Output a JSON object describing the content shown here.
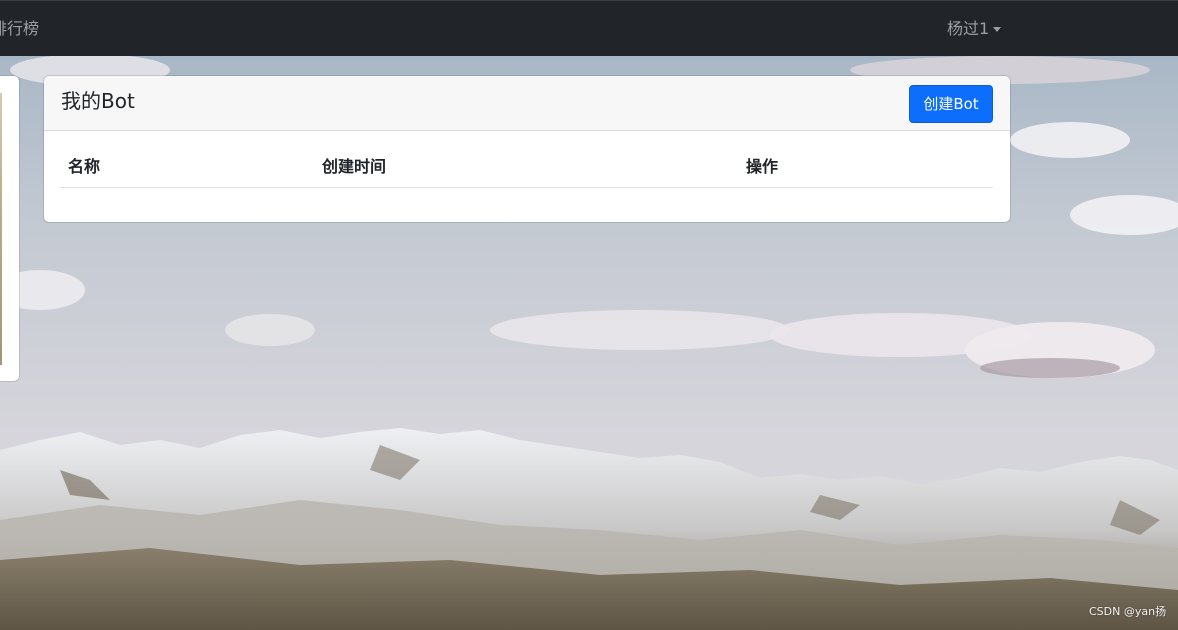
{
  "navbar": {
    "ranklist_link": "排行榜",
    "username": "杨过1"
  },
  "bot_card": {
    "title": "我的Bot",
    "create_button": "创建Bot",
    "table": {
      "headers": [
        "名称",
        "创建时间",
        "操作"
      ],
      "rows": []
    }
  },
  "watermark": "CSDN @yan扬",
  "colors": {
    "navbar_bg": "#212529",
    "primary_button": "#0d6efd",
    "card_header_bg": "#f7f7f7"
  }
}
